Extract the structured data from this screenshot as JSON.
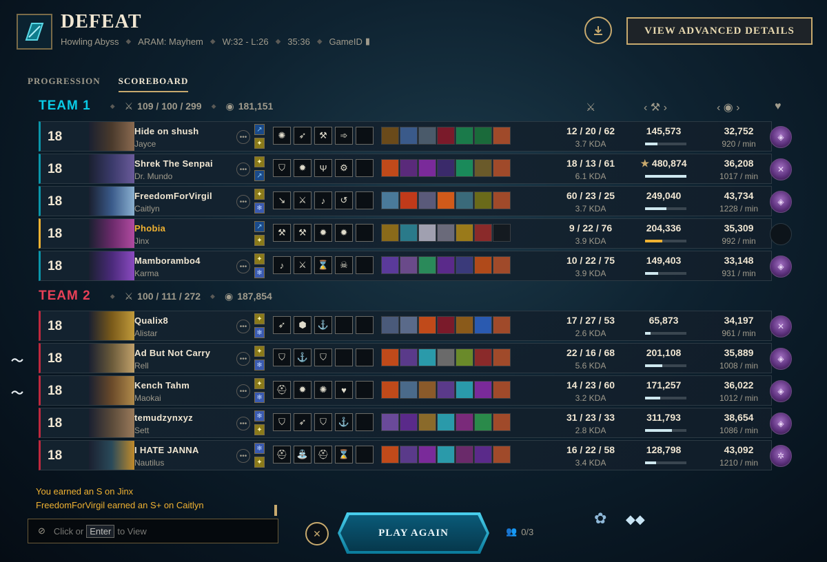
{
  "header": {
    "result": "DEFEAT",
    "map": "Howling Abyss",
    "mode": "ARAM: Mayhem",
    "record": "W:32 - L:26",
    "duration": "35:36",
    "game_id_label": "GameID",
    "advanced_button": "VIEW ADVANCED DETAILS"
  },
  "tabs": [
    "PROGRESSION",
    "SCOREBOARD"
  ],
  "team1": {
    "name": "TEAM 1",
    "kda": "109 / 100 / 299",
    "gold": "181,151",
    "players": [
      {
        "level": "18",
        "name": "Hide on shush",
        "champion": "Jayce",
        "kda": "12 / 20 / 62",
        "kda_ratio": "3.7 KDA",
        "damage": "145,573",
        "damage_fraction": 0.3,
        "gold": "32,752",
        "gpm": "920 / min",
        "me": false
      },
      {
        "level": "18",
        "name": "Shrek The Senpai",
        "champion": "Dr. Mundo",
        "kda": "18 / 13 / 61",
        "kda_ratio": "6.1 KDA",
        "damage": "480,874",
        "damage_fraction": 1.0,
        "gold": "36,208",
        "gpm": "1017 / min",
        "me": false,
        "top_damage": true
      },
      {
        "level": "18",
        "name": "FreedomForVirgil",
        "champion": "Caitlyn",
        "kda": "60 / 23 / 25",
        "kda_ratio": "3.7 KDA",
        "damage": "249,040",
        "damage_fraction": 0.52,
        "gold": "43,734",
        "gpm": "1228 / min",
        "me": false
      },
      {
        "level": "18",
        "name": "Phobia",
        "champion": "Jinx",
        "kda": "9 / 22 / 76",
        "kda_ratio": "3.9 KDA",
        "damage": "204,336",
        "damage_fraction": 0.42,
        "gold": "35,309",
        "gpm": "992 / min",
        "me": true
      },
      {
        "level": "18",
        "name": "Mamborambo4",
        "champion": "Karma",
        "kda": "10 / 22 / 75",
        "kda_ratio": "3.9 KDA",
        "damage": "149,403",
        "damage_fraction": 0.31,
        "gold": "33,148",
        "gpm": "931 / min",
        "me": false
      }
    ]
  },
  "team2": {
    "name": "TEAM 2",
    "kda": "100 / 111 / 272",
    "gold": "187,854",
    "players": [
      {
        "level": "18",
        "name": "Qualix8",
        "champion": "Alistar",
        "kda": "17 / 27 / 53",
        "kda_ratio": "2.6 KDA",
        "damage": "65,873",
        "damage_fraction": 0.14,
        "gold": "34,197",
        "gpm": "961 / min"
      },
      {
        "level": "18",
        "name": "Ad But Not Carry",
        "champion": "Rell",
        "kda": "22 / 16 / 68",
        "kda_ratio": "5.6 KDA",
        "damage": "201,108",
        "damage_fraction": 0.42,
        "gold": "35,889",
        "gpm": "1008 / min"
      },
      {
        "level": "18",
        "name": "Kench Tahm",
        "champion": "Maokai",
        "kda": "14 / 23 / 60",
        "kda_ratio": "3.2 KDA",
        "damage": "171,257",
        "damage_fraction": 0.36,
        "gold": "36,022",
        "gpm": "1012 / min"
      },
      {
        "level": "18",
        "name": "temudzynxyz",
        "champion": "Sett",
        "kda": "31 / 23 / 33",
        "kda_ratio": "2.8 KDA",
        "damage": "311,793",
        "damage_fraction": 0.65,
        "gold": "38,654",
        "gpm": "1086 / min"
      },
      {
        "level": "18",
        "name": "I HATE JANNA",
        "champion": "Nautilus",
        "kda": "16 / 22 / 58",
        "kda_ratio": "3.4 KDA",
        "damage": "128,798",
        "damage_fraction": 0.27,
        "gold": "43,092",
        "gpm": "1210 / min"
      }
    ]
  },
  "chat": {
    "lines": [
      "You earned an S on Jinx",
      "FreedomForVirgil earned an S+ on Caitlyn"
    ],
    "input_prefix": "Click or",
    "input_key": "Enter",
    "input_suffix": "to View"
  },
  "footer": {
    "play_again": "PLAY AGAIN",
    "party_count": "0/3"
  },
  "colors": {
    "team1": "#0acbe6",
    "team2": "#e84057",
    "gold_accent": "#c8aa6e",
    "me_highlight": "#f0b232"
  }
}
